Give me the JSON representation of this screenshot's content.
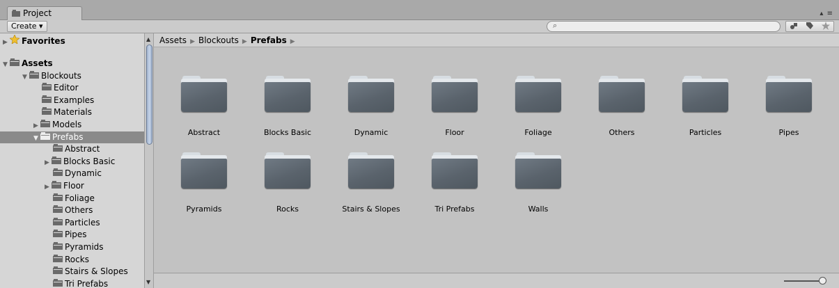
{
  "tab": {
    "label": "Project",
    "menu": "▴ ≡"
  },
  "toolbar": {
    "create_label": "Create ▾",
    "search_icon": "⌕"
  },
  "tree": {
    "favorites": "Favorites",
    "assets": "Assets",
    "blockouts": "Blockouts",
    "editor": "Editor",
    "examples": "Examples",
    "materials": "Materials",
    "models": "Models",
    "prefabs": "Prefabs",
    "abstract": "Abstract",
    "blocks_basic": "Blocks Basic",
    "dynamic": "Dynamic",
    "floor": "Floor",
    "foliage": "Foliage",
    "others": "Others",
    "particles": "Particles",
    "pipes": "Pipes",
    "pyramids": "Pyramids",
    "rocks": "Rocks",
    "stairs_slopes": "Stairs & Slopes",
    "tri_prefabs": "Tri Prefabs"
  },
  "breadcrumb": {
    "items": [
      "Assets",
      "Blockouts",
      "Prefabs"
    ]
  },
  "folders": [
    "Abstract",
    "Blocks Basic",
    "Dynamic",
    "Floor",
    "Foliage",
    "Others",
    "Particles",
    "Pipes",
    "Pyramids",
    "Rocks",
    "Stairs & Slopes",
    "Tri Prefabs",
    "Walls"
  ],
  "icons": {
    "tab": "folder-icon",
    "favorites": "star-icon",
    "folder": "folder-icon",
    "search": "search-icon"
  }
}
